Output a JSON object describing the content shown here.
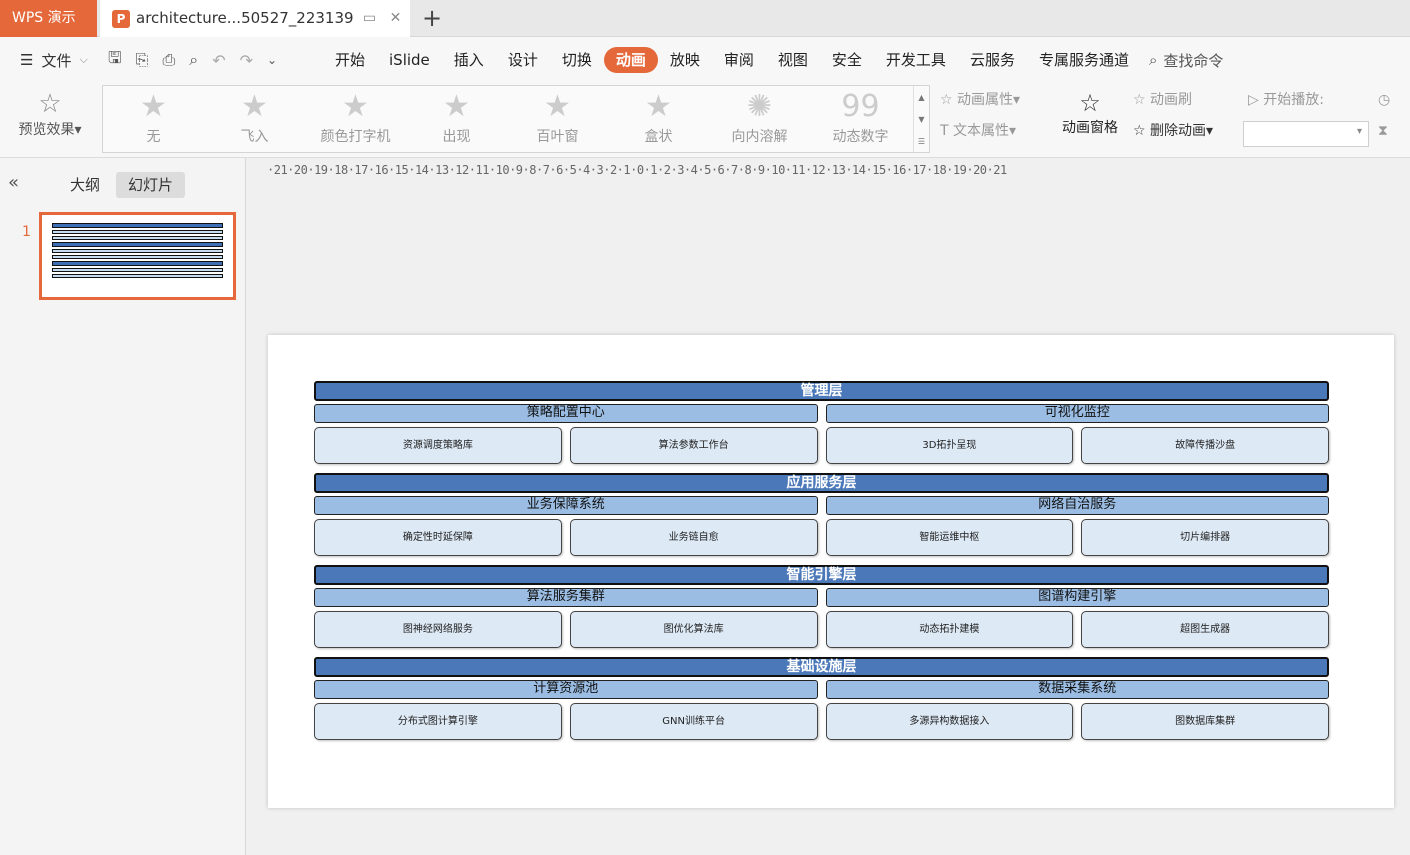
{
  "app": {
    "wps_tab": "WPS 演示",
    "doc_tab_icon": "P",
    "doc_tab_title": "architecture...50527_223139"
  },
  "menubar": {
    "file_label": "文件",
    "items": [
      "开始",
      "iSlide",
      "插入",
      "设计",
      "切换",
      "动画",
      "放映",
      "审阅",
      "视图",
      "安全",
      "开发工具",
      "云服务",
      "专属服务通道"
    ],
    "active": "动画",
    "search_label": "查找命令"
  },
  "ribbon": {
    "preview_label": "预览效果",
    "gallery": [
      {
        "icon": "star-icon",
        "label": "无"
      },
      {
        "icon": "fly-in-icon",
        "label": "飞入"
      },
      {
        "icon": "color-typewriter-icon",
        "label": "颜色打字机"
      },
      {
        "icon": "appear-icon",
        "label": "出现"
      },
      {
        "icon": "blinds-icon",
        "label": "百叶窗"
      },
      {
        "icon": "box-icon",
        "label": "盒状"
      },
      {
        "icon": "dissolve-in-icon",
        "label": "向内溶解"
      },
      {
        "icon": "dynamic-number-icon",
        "label": "动态数字",
        "glyph": "99"
      }
    ],
    "anim_props": "动画属性",
    "text_props": "文本属性",
    "anim_pane": "动画窗格",
    "anim_brush": "动画刷",
    "delete_anim": "删除动画",
    "start_play": "开始播放:"
  },
  "left_panel": {
    "tab_outline": "大纲",
    "tab_slides": "幻灯片",
    "slide_number": "1"
  },
  "ruler_text": "·21·20·19·18·17·16·15·14·13·12·11·10·9·8·7·6·5·4·3·2·1·0·1·2·3·4·5·6·7·8·9·10·11·12·13·14·15·16·17·18·19·20·21",
  "slide": {
    "layers": [
      {
        "title": "管理层",
        "groups": [
          {
            "title": "策略配置中心",
            "items": [
              "资源调度策略库",
              "算法参数工作台"
            ]
          },
          {
            "title": "可视化监控",
            "items": [
              "3D拓扑呈现",
              "故障传播沙盘"
            ]
          }
        ]
      },
      {
        "title": "应用服务层",
        "groups": [
          {
            "title": "业务保障系统",
            "items": [
              "确定性时延保障",
              "业务链自愈"
            ]
          },
          {
            "title": "网络自治服务",
            "items": [
              "智能运维中枢",
              "切片编排器"
            ]
          }
        ]
      },
      {
        "title": "智能引擎层",
        "groups": [
          {
            "title": "算法服务集群",
            "items": [
              "图神经网络服务",
              "图优化算法库"
            ]
          },
          {
            "title": "图谱构建引擎",
            "items": [
              "动态拓扑建模",
              "超图生成器"
            ]
          }
        ]
      },
      {
        "title": "基础设施层",
        "groups": [
          {
            "title": "计算资源池",
            "items": [
              "分布式图计算引擎",
              "GNN训练平台"
            ]
          },
          {
            "title": "数据采集系统",
            "items": [
              "多源异构数据接入",
              "图数据库集群"
            ]
          }
        ]
      }
    ]
  }
}
